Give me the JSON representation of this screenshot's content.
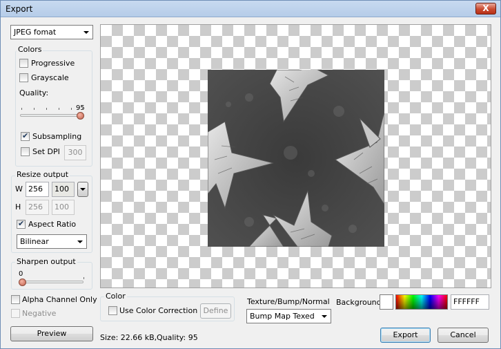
{
  "window": {
    "title": "Export",
    "close_glyph": "X"
  },
  "format_select": {
    "value": "JPEG fomat"
  },
  "colors_group": {
    "label": "Colors",
    "progressive": {
      "label": "Progressive",
      "checked": false
    },
    "grayscale": {
      "label": "Grayscale",
      "checked": false
    },
    "quality_label": "Quality:",
    "quality_value": "95",
    "quality": 95,
    "subsampling": {
      "label": "Subsampling",
      "checked": true
    },
    "set_dpi": {
      "label": "Set DPI",
      "checked": false,
      "value": "300"
    }
  },
  "resize_group": {
    "label": "Resize output",
    "w_label": "W",
    "width": "256",
    "width_percent": "100",
    "h_label": "H",
    "height": "256",
    "height_percent": "100",
    "aspect_ratio": {
      "label": "Aspect Ratio",
      "checked": true
    },
    "filter_select": "Bilinear"
  },
  "sharpen_group": {
    "label": "Sharpen output",
    "value_label": "0",
    "value": 0
  },
  "alpha_channel_only": {
    "label": "Alpha Channel Only",
    "checked": false
  },
  "negative": {
    "label": "Negative",
    "checked": false,
    "disabled": true
  },
  "preview_button": "Preview",
  "status": {
    "size": "Size: 22.66 kB,",
    "quality": "Quality: 95"
  },
  "color_group": {
    "label": "Color",
    "use_color_correction": {
      "label": "Use Color Correction",
      "checked": false
    },
    "define_button": "Define"
  },
  "texture_type": {
    "label": "Texture/Bump/Normal",
    "value": "Bump Map Texed"
  },
  "background": {
    "label": "Background",
    "hex": "FFFFFF",
    "swatch_color": "#ffffff"
  },
  "export_button": "Export",
  "cancel_button": "Cancel"
}
